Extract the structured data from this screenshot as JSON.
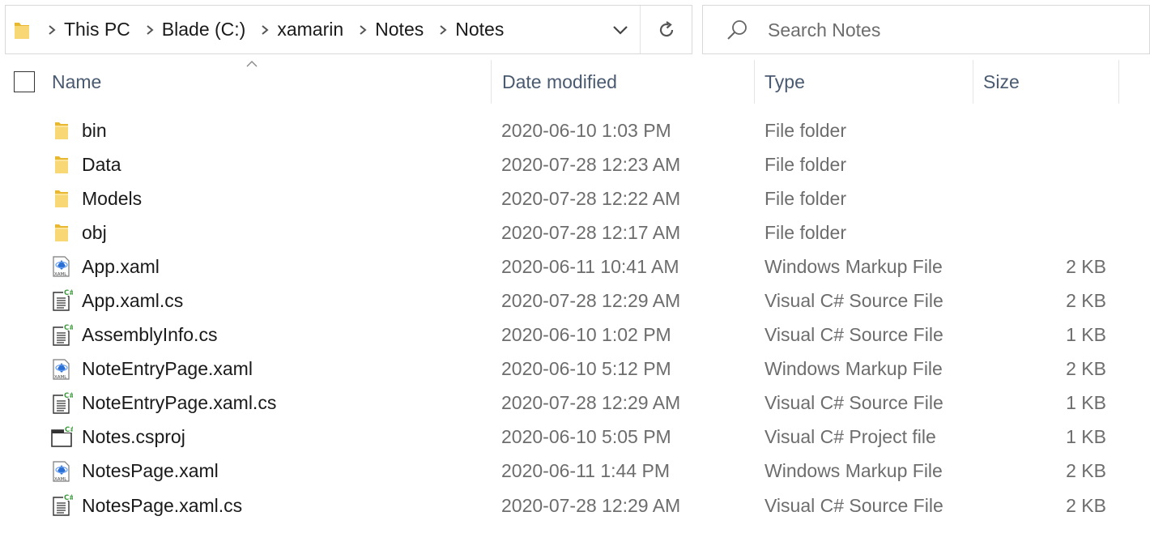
{
  "address_bar": {
    "breadcrumbs": [
      "This PC",
      "Blade (C:)",
      "xamarin",
      "Notes",
      "Notes"
    ]
  },
  "search": {
    "placeholder": "Search Notes",
    "value": ""
  },
  "columns": {
    "name": "Name",
    "date": "Date modified",
    "type": "Type",
    "size": "Size"
  },
  "sort": {
    "column": "name",
    "direction": "ascending"
  },
  "files": [
    {
      "name": "bin",
      "date": "2020-06-10 1:03 PM",
      "type": "File folder",
      "size": "",
      "icon": "folder-icon"
    },
    {
      "name": "Data",
      "date": "2020-07-28 12:23 AM",
      "type": "File folder",
      "size": "",
      "icon": "folder-icon"
    },
    {
      "name": "Models",
      "date": "2020-07-28 12:22 AM",
      "type": "File folder",
      "size": "",
      "icon": "folder-icon"
    },
    {
      "name": "obj",
      "date": "2020-07-28 12:17 AM",
      "type": "File folder",
      "size": "",
      "icon": "folder-icon"
    },
    {
      "name": "App.xaml",
      "date": "2020-06-11 10:41 AM",
      "type": "Windows Markup File",
      "size": "2 KB",
      "icon": "xaml-file-icon"
    },
    {
      "name": "App.xaml.cs",
      "date": "2020-07-28 12:29 AM",
      "type": "Visual C# Source File",
      "size": "2 KB",
      "icon": "csharp-file-icon"
    },
    {
      "name": "AssemblyInfo.cs",
      "date": "2020-06-10 1:02 PM",
      "type": "Visual C# Source File",
      "size": "1 KB",
      "icon": "csharp-file-icon"
    },
    {
      "name": "NoteEntryPage.xaml",
      "date": "2020-06-10 5:12 PM",
      "type": "Windows Markup File",
      "size": "2 KB",
      "icon": "xaml-file-icon"
    },
    {
      "name": "NoteEntryPage.xaml.cs",
      "date": "2020-07-28 12:29 AM",
      "type": "Visual C# Source File",
      "size": "1 KB",
      "icon": "csharp-file-icon"
    },
    {
      "name": "Notes.csproj",
      "date": "2020-06-10 5:05 PM",
      "type": "Visual C# Project file",
      "size": "1 KB",
      "icon": "csproj-file-icon"
    },
    {
      "name": "NotesPage.xaml",
      "date": "2020-06-11 1:44 PM",
      "type": "Windows Markup File",
      "size": "2 KB",
      "icon": "xaml-file-icon"
    },
    {
      "name": "NotesPage.xaml.cs",
      "date": "2020-07-28 12:29 AM",
      "type": "Visual C# Source File",
      "size": "2 KB",
      "icon": "csharp-file-icon"
    }
  ],
  "colors": {
    "folder": "#f8d775",
    "header_text": "#4a5a70",
    "secondary_text": "#6d6d6d",
    "csharp_badge": "#3c9a3c",
    "xaml_badge": "#2a6fd6"
  }
}
